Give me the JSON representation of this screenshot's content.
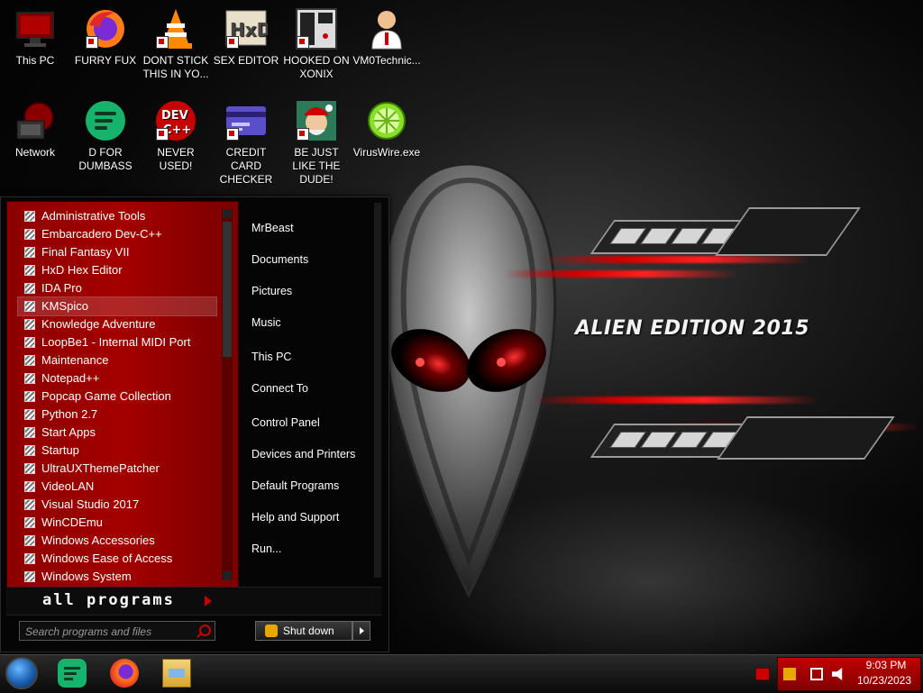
{
  "wallpaper": {
    "brand_text": "ALIEN EDITION 2015"
  },
  "desktop_icons": [
    {
      "label": "This PC",
      "icon": "this-pc-icon"
    },
    {
      "label": "FURRY FUX",
      "icon": "firefox-icon"
    },
    {
      "label": "DONT STICK THIS IN YO...",
      "icon": "vlc-cone-icon"
    },
    {
      "label": "SEX EDITOR",
      "icon": "hxd-editor-icon"
    },
    {
      "label": "HOOKED ON XONIX",
      "icon": "xonix-game-icon"
    },
    {
      "label": "VM0Technic...",
      "icon": "doctor-user-icon"
    },
    {
      "label": "Network",
      "icon": "network-icon"
    },
    {
      "label": "D FOR DUMBASS",
      "icon": "green-chat-icon"
    },
    {
      "label": "NEVER USED!",
      "icon": "dev-cpp-icon"
    },
    {
      "label": "CREDIT CARD CHECKER",
      "icon": "credit-card-icon"
    },
    {
      "label": "BE JUST LIKE THE DUDE!",
      "icon": "dude-santa-icon"
    },
    {
      "label": "VirusWire.exe",
      "icon": "lime-wire-icon"
    }
  ],
  "start_menu": {
    "programs": [
      "Administrative Tools",
      "Embarcadero Dev-C++",
      "Final Fantasy VII",
      "HxD Hex Editor",
      "IDA Pro",
      "KMSpico",
      "Knowledge Adventure",
      "LoopBe1 - Internal MIDI Port",
      "Maintenance",
      "Notepad++",
      "Popcap Game Collection",
      "Python 2.7",
      "Start Apps",
      "Startup",
      "UltraUXThemePatcher",
      "VideoLAN",
      "Visual Studio 2017",
      "WinCDEmu",
      "Windows Accessories",
      "Windows Ease of Access",
      "Windows System"
    ],
    "hovered_program": "KMSpico",
    "right_links": [
      "MrBeast",
      "Documents",
      "Pictures",
      "Music",
      "This PC",
      "Connect To",
      "Control Panel",
      "Devices and Printers",
      "Default Programs",
      "Help and Support",
      "Run..."
    ],
    "all_programs_label": "all programs",
    "search_placeholder": "Search programs and files",
    "shutdown_label": "Shut down"
  },
  "taskbar": {
    "pinned": [
      "green-chat-icon",
      "firefox-icon",
      "file-explorer-icon"
    ],
    "clock_time": "9:03 PM",
    "clock_date": "10/23/2023"
  }
}
